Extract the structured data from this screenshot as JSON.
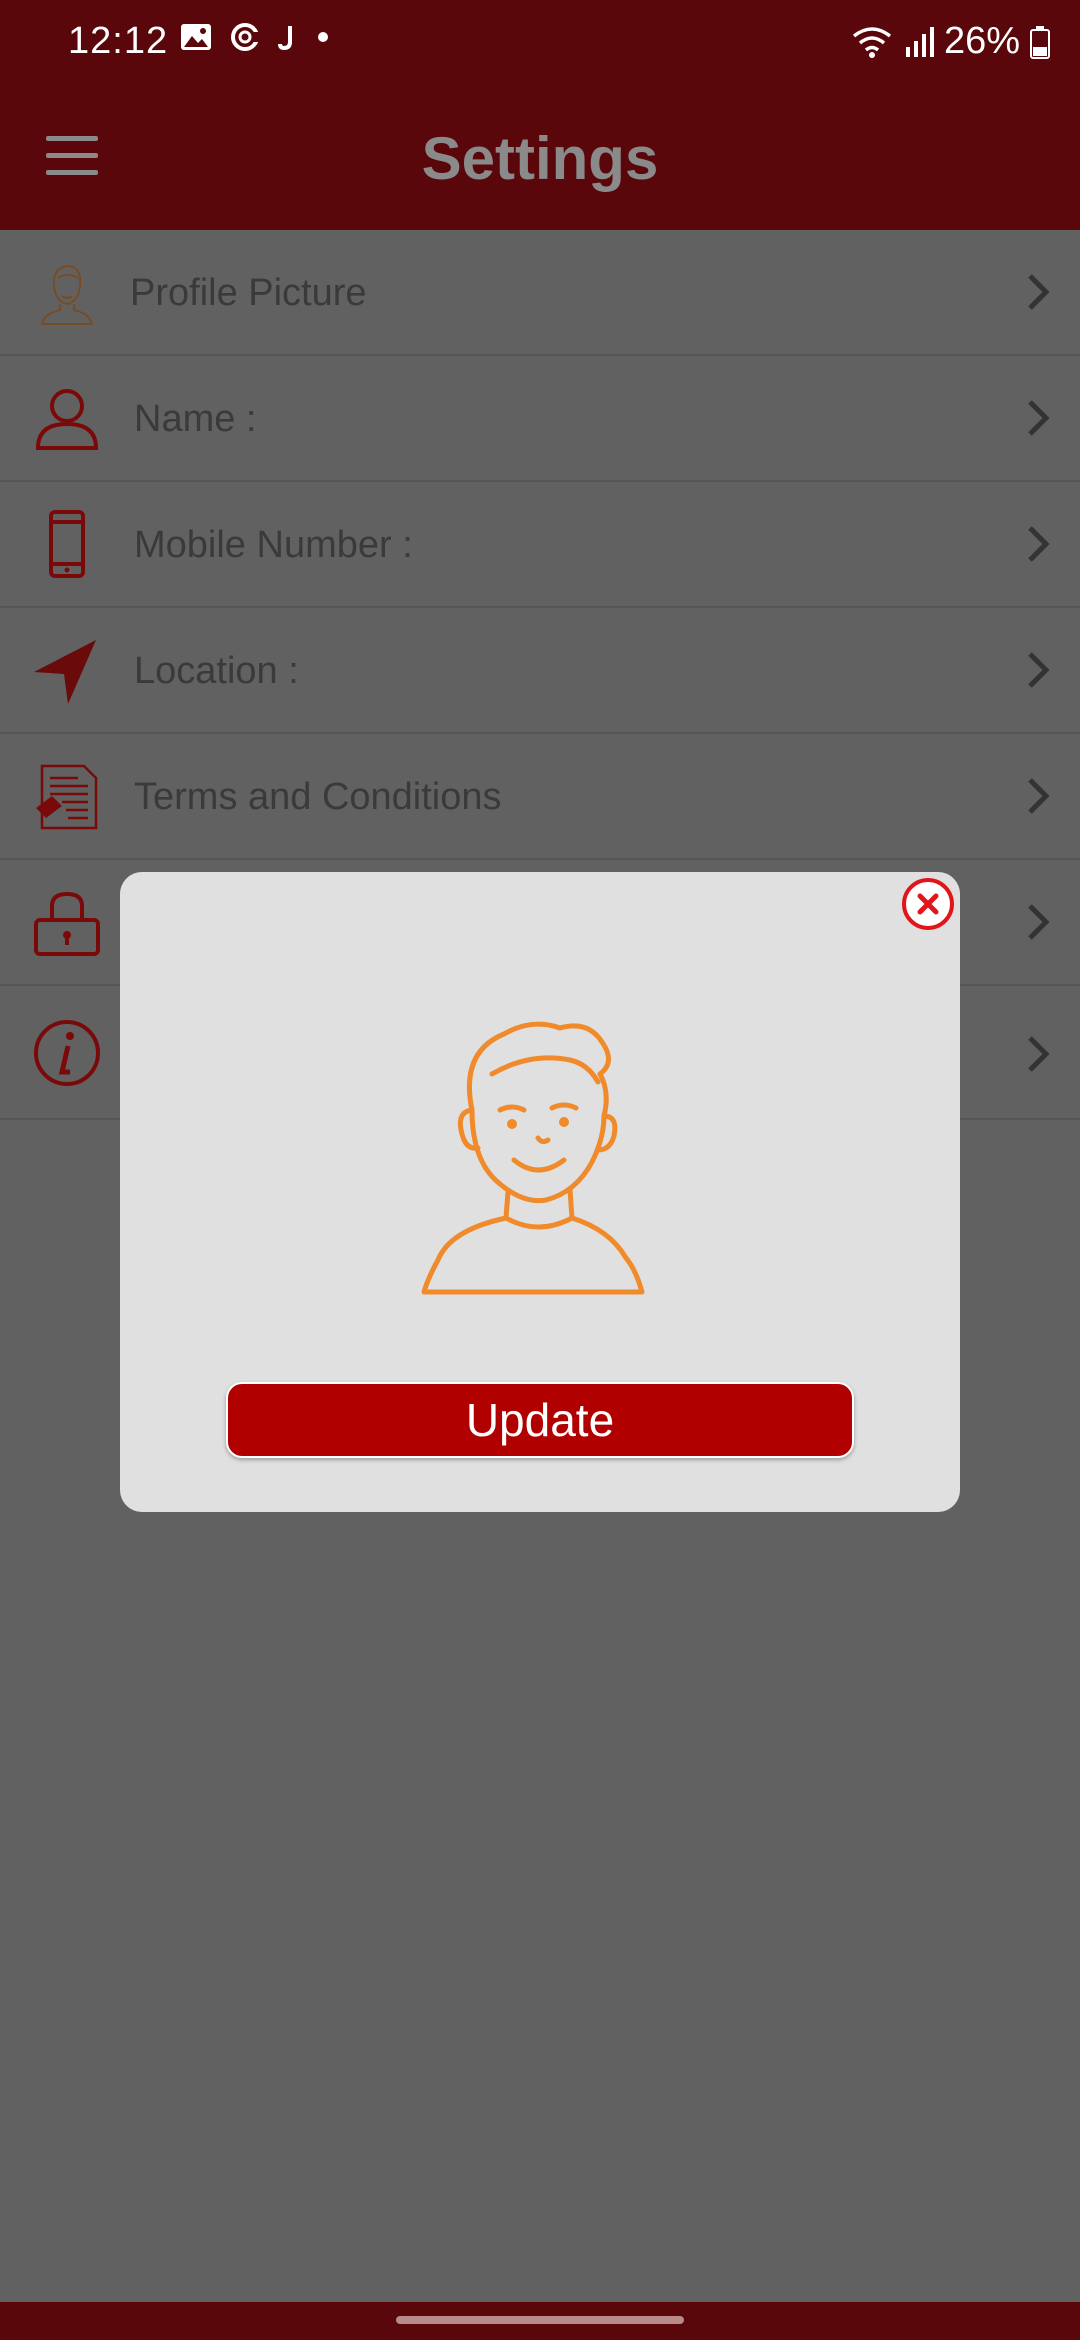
{
  "status_bar": {
    "time": "12:12",
    "battery": "26%",
    "left_icons": [
      "gallery-icon",
      "c-icon",
      "j-icon",
      "dot-icon"
    ],
    "right_icons": [
      "wifi-icon",
      "signal-icon",
      "battery-icon"
    ]
  },
  "app_bar": {
    "title": "Settings",
    "menu_icon": "hamburger-menu-icon"
  },
  "settings": {
    "items": [
      {
        "label": "Profile Picture",
        "icon": "profile-avatar-icon"
      },
      {
        "label": "Name :",
        "icon": "person-icon"
      },
      {
        "label": "Mobile Number :",
        "icon": "mobile-phone-icon"
      },
      {
        "label": "Location :",
        "icon": "location-arrow-icon"
      },
      {
        "label": "Terms and Conditions",
        "icon": "document-icon"
      },
      {
        "label": "",
        "icon": "lock-icon"
      },
      {
        "label": "",
        "icon": "info-icon"
      }
    ]
  },
  "modal": {
    "update_label": "Update",
    "close_icon": "close-circle-icon",
    "avatar_icon": "avatar-illustration-icon"
  },
  "colors": {
    "primary_dark": "#5a070b",
    "accent_red": "#b10000",
    "avatar_orange": "#f08a2a",
    "overlay": "#616161",
    "modal_bg": "#e0e0e0"
  }
}
